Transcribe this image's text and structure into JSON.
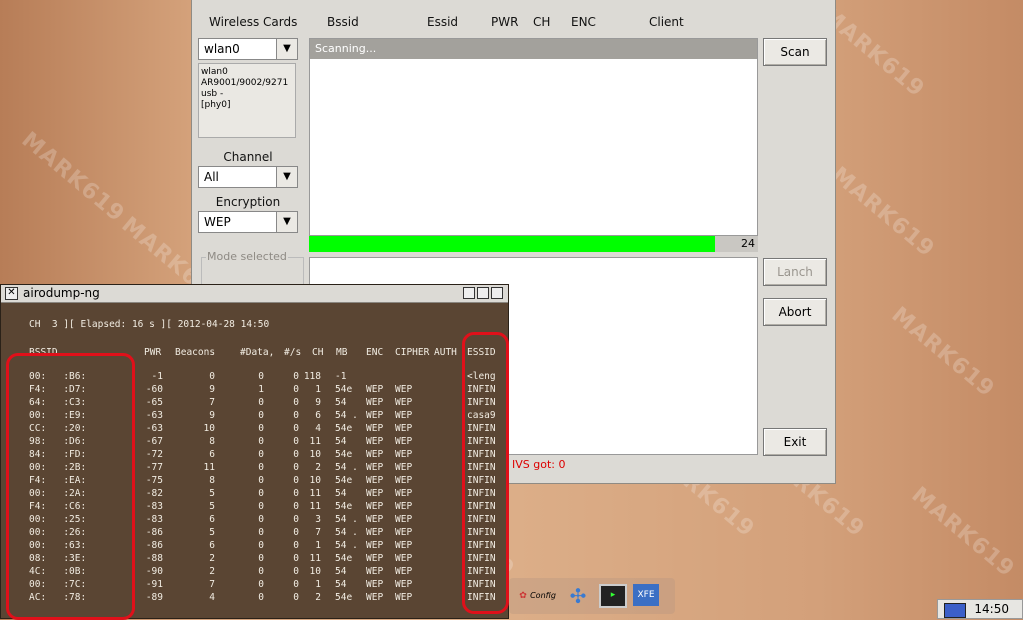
{
  "main": {
    "headers": {
      "wireless_cards": "Wireless Cards",
      "bssid": "Bssid",
      "essid": "Essid",
      "pwr": "PWR",
      "ch": "CH",
      "enc": "ENC",
      "client": "Client"
    },
    "card_combo": "wlan0",
    "card_info": [
      "wlan0",
      "AR9001/9002/9271 usb -",
      "[phy0]"
    ],
    "channel_label": "Channel",
    "channel_combo": "All",
    "encryption_label": "Encryption",
    "encryption_combo": "WEP",
    "mode_label": "Mode selected",
    "scan_status": "Scanning...",
    "progress_value": 24,
    "progress_fraction": 0.905,
    "ivs_text": "IVS got: 0",
    "buttons": {
      "scan": "Scan",
      "lanch": "Lanch",
      "abort": "Abort",
      "exit": "Exit"
    }
  },
  "terminal": {
    "title": "airodump-ng",
    "status_line": "CH  3 ][ Elapsed: 16 s ][ 2012-04-28 14:50",
    "columns": [
      "BSSID",
      "PWR",
      "Beacons",
      "#Data,",
      "#/s",
      "CH",
      "MB",
      "ENC",
      "CIPHER",
      "AUTH",
      "ESSID"
    ],
    "rows": [
      {
        "bssid": "00:   :B6:",
        "pwr": "-1",
        "beacons": "0",
        "data": "0",
        "s": "0",
        "ch": "118",
        "mb": "-1",
        "enc": "",
        "cipher": "",
        "essid": "<leng"
      },
      {
        "bssid": "F4:   :D7:",
        "pwr": "-60",
        "beacons": "9",
        "data": "1",
        "s": "0",
        "ch": "1",
        "mb": "54e",
        "enc": "WEP",
        "cipher": "WEP",
        "essid": "INFIN"
      },
      {
        "bssid": "64:   :C3:",
        "pwr": "-65",
        "beacons": "7",
        "data": "0",
        "s": "0",
        "ch": "9",
        "mb": "54",
        "enc": "WEP",
        "cipher": "WEP",
        "essid": "INFIN"
      },
      {
        "bssid": "00:   :E9:",
        "pwr": "-63",
        "beacons": "9",
        "data": "0",
        "s": "0",
        "ch": "6",
        "mb": "54 .",
        "enc": "WEP",
        "cipher": "WEP",
        "essid": "casa9"
      },
      {
        "bssid": "CC:   :20:",
        "pwr": "-63",
        "beacons": "10",
        "data": "0",
        "s": "0",
        "ch": "4",
        "mb": "54e",
        "enc": "WEP",
        "cipher": "WEP",
        "essid": "INFIN"
      },
      {
        "bssid": "98:   :D6:",
        "pwr": "-67",
        "beacons": "8",
        "data": "0",
        "s": "0",
        "ch": "11",
        "mb": "54",
        "enc": "WEP",
        "cipher": "WEP",
        "essid": "INFIN"
      },
      {
        "bssid": "84:   :FD:",
        "pwr": "-72",
        "beacons": "6",
        "data": "0",
        "s": "0",
        "ch": "10",
        "mb": "54e",
        "enc": "WEP",
        "cipher": "WEP",
        "essid": "INFIN"
      },
      {
        "bssid": "00:   :2B:",
        "pwr": "-77",
        "beacons": "11",
        "data": "0",
        "s": "0",
        "ch": "2",
        "mb": "54 .",
        "enc": "WEP",
        "cipher": "WEP",
        "essid": "INFIN"
      },
      {
        "bssid": "F4:   :EA:",
        "pwr": "-75",
        "beacons": "8",
        "data": "0",
        "s": "0",
        "ch": "10",
        "mb": "54e",
        "enc": "WEP",
        "cipher": "WEP",
        "essid": "INFIN"
      },
      {
        "bssid": "00:   :2A:",
        "pwr": "-82",
        "beacons": "5",
        "data": "0",
        "s": "0",
        "ch": "11",
        "mb": "54",
        "enc": "WEP",
        "cipher": "WEP",
        "essid": "INFIN"
      },
      {
        "bssid": "F4:   :C6:",
        "pwr": "-83",
        "beacons": "5",
        "data": "0",
        "s": "0",
        "ch": "11",
        "mb": "54e",
        "enc": "WEP",
        "cipher": "WEP",
        "essid": "INFIN"
      },
      {
        "bssid": "00:   :25:",
        "pwr": "-83",
        "beacons": "6",
        "data": "0",
        "s": "0",
        "ch": "3",
        "mb": "54 .",
        "enc": "WEP",
        "cipher": "WEP",
        "essid": "INFIN"
      },
      {
        "bssid": "00:   :26:",
        "pwr": "-86",
        "beacons": "5",
        "data": "0",
        "s": "0",
        "ch": "7",
        "mb": "54 .",
        "enc": "WEP",
        "cipher": "WEP",
        "essid": "INFIN"
      },
      {
        "bssid": "00:   :63:",
        "pwr": "-86",
        "beacons": "6",
        "data": "0",
        "s": "0",
        "ch": "1",
        "mb": "54 .",
        "enc": "WEP",
        "cipher": "WEP",
        "essid": "INFIN"
      },
      {
        "bssid": "08:   :3E:",
        "pwr": "-88",
        "beacons": "2",
        "data": "0",
        "s": "0",
        "ch": "11",
        "mb": "54e",
        "enc": "WEP",
        "cipher": "WEP",
        "essid": "INFIN"
      },
      {
        "bssid": "4C:   :0B:",
        "pwr": "-90",
        "beacons": "2",
        "data": "0",
        "s": "0",
        "ch": "10",
        "mb": "54",
        "enc": "WEP",
        "cipher": "WEP",
        "essid": "INFIN"
      },
      {
        "bssid": "00:   :7C:",
        "pwr": "-91",
        "beacons": "7",
        "data": "0",
        "s": "0",
        "ch": "1",
        "mb": "54",
        "enc": "WEP",
        "cipher": "WEP",
        "essid": "INFIN"
      },
      {
        "bssid": "AC:   :78:",
        "pwr": "-89",
        "beacons": "4",
        "data": "0",
        "s": "0",
        "ch": "2",
        "mb": "54e",
        "enc": "WEP",
        "cipher": "WEP",
        "essid": "INFIN"
      }
    ]
  },
  "taskbar": {
    "clock": "14:50"
  },
  "dock": {
    "xfe_label": "XFE",
    "config_label": "Config"
  },
  "watermark": "MARK619",
  "colors": {
    "progress": "#00ff00",
    "terminal_bg": "#5a4533",
    "highlight": "#e0101a"
  }
}
